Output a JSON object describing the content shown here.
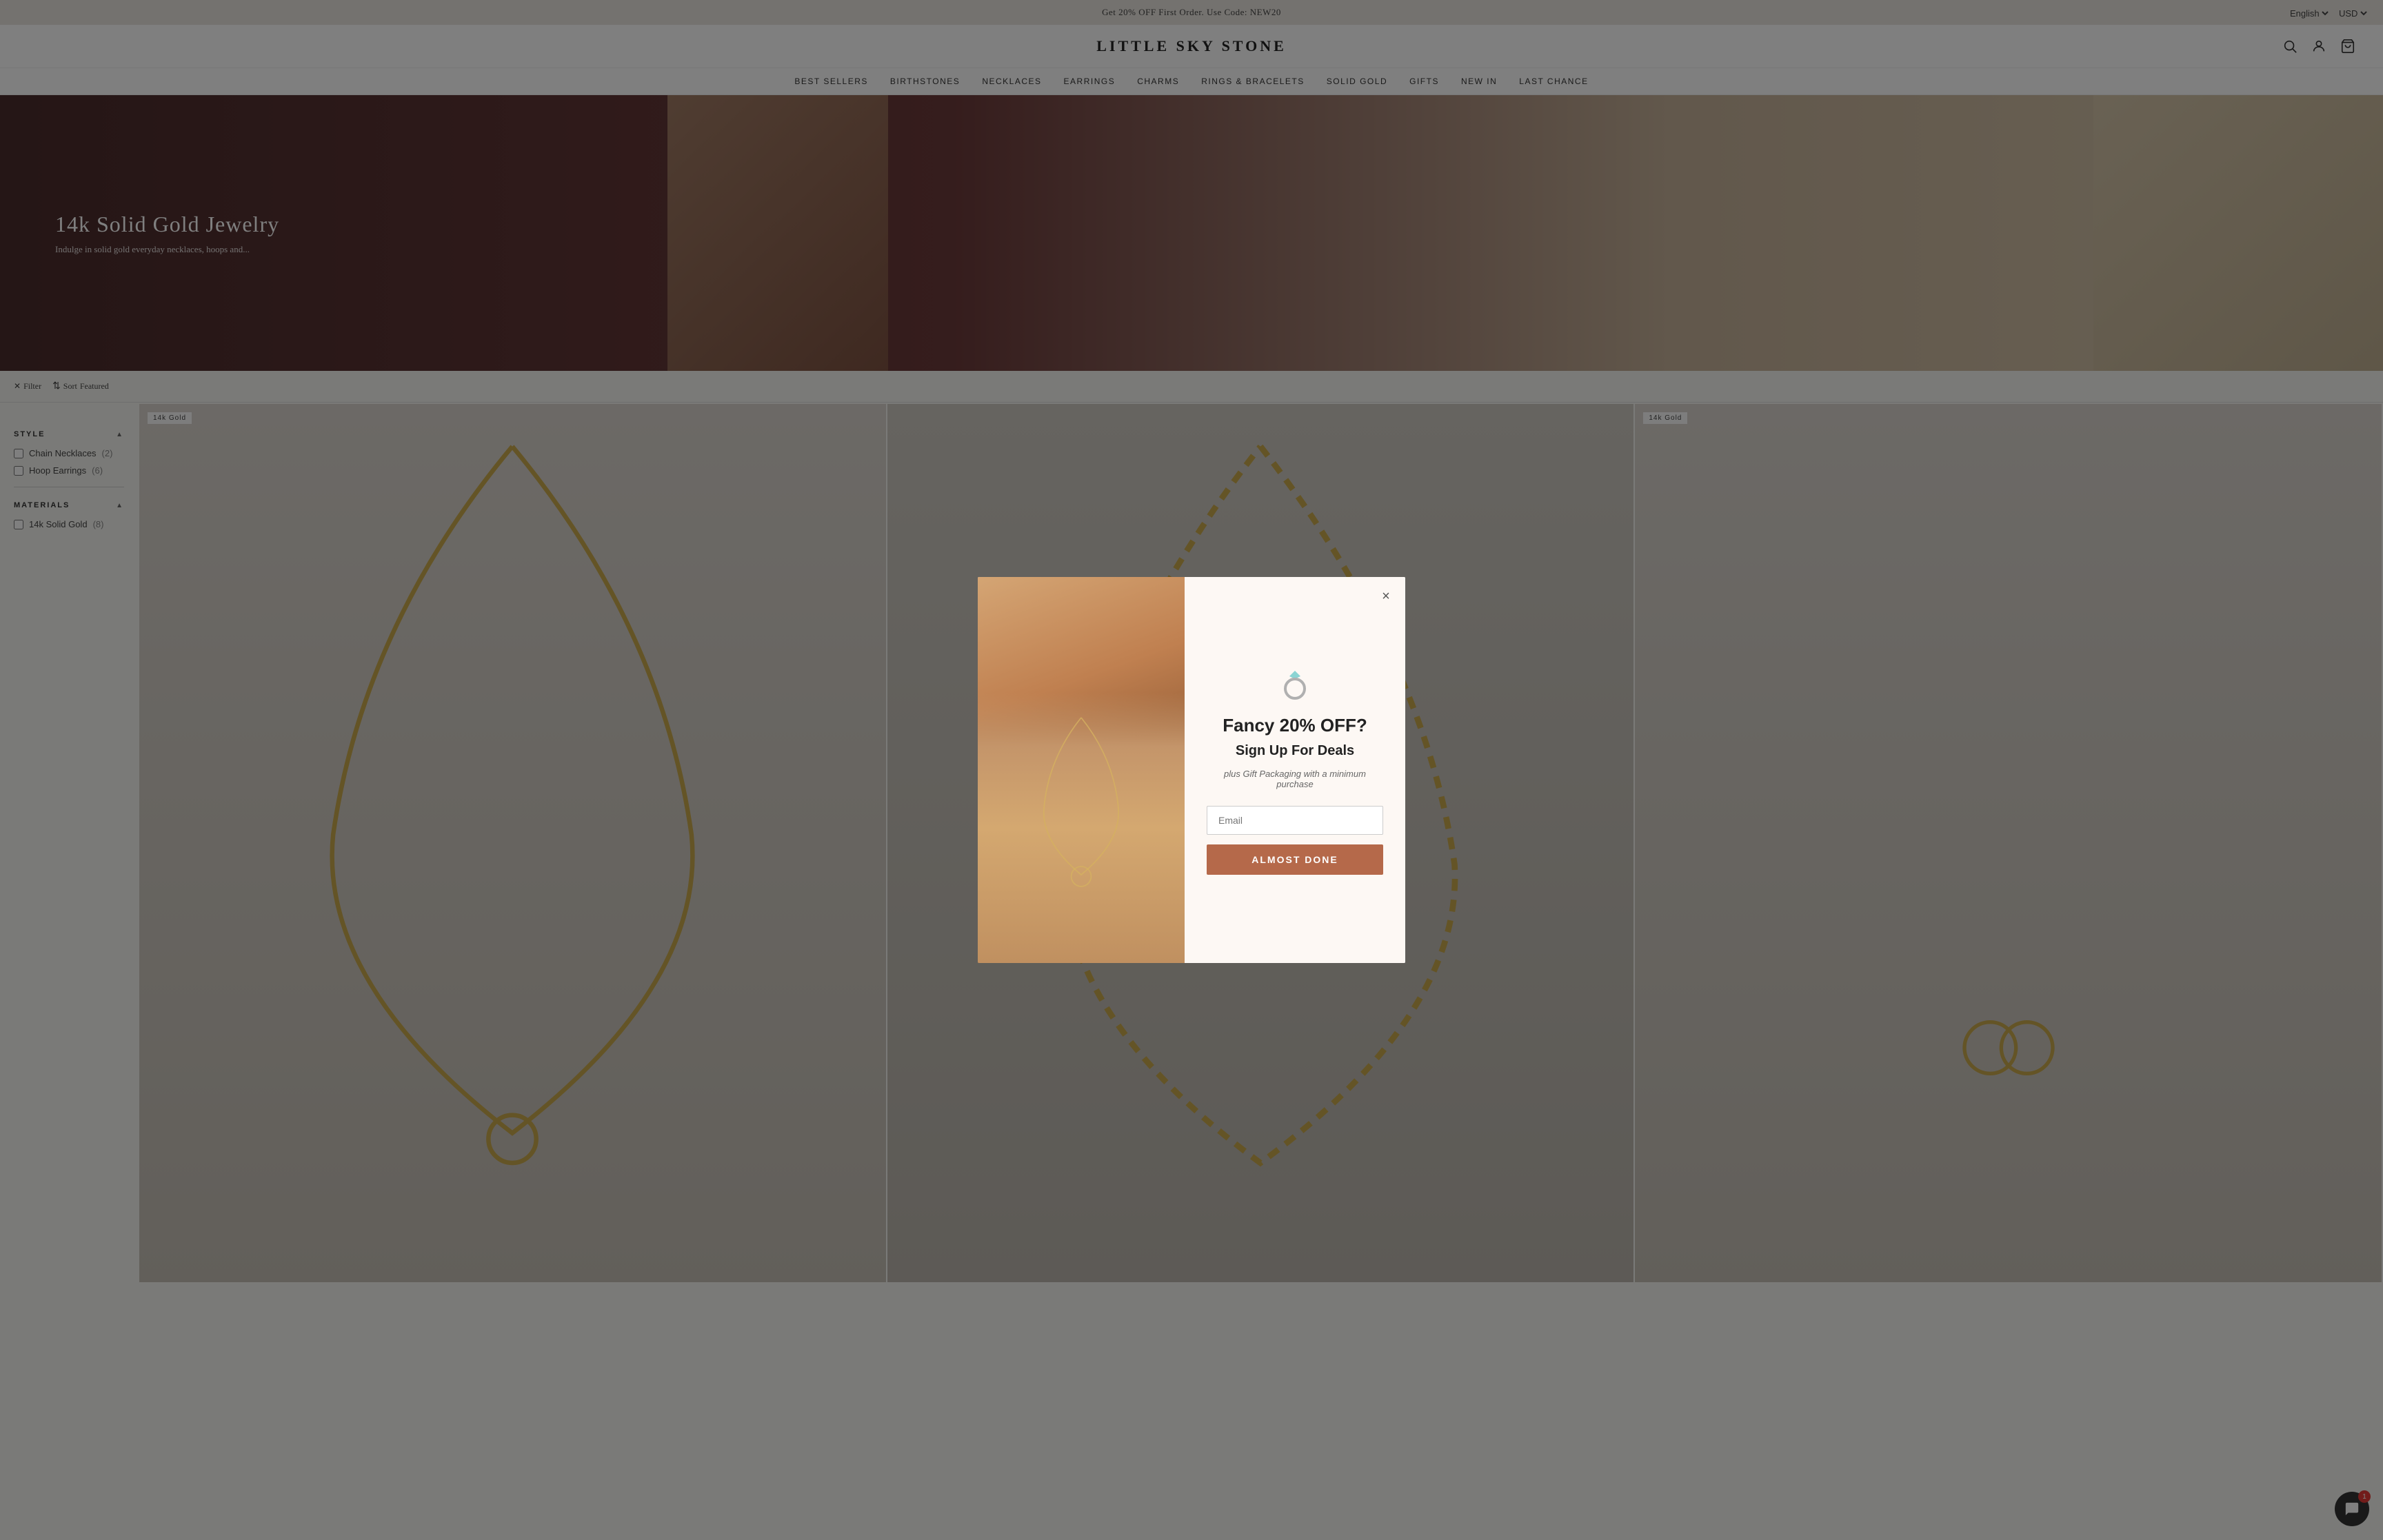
{
  "banner": {
    "promo_text": "Get 20% OFF First Order. Use Code: NEW20",
    "language": "English",
    "currency": "USD"
  },
  "header": {
    "logo": "LITTLE SKY STONE",
    "icons": {
      "search": "search-icon",
      "account": "account-icon",
      "cart": "cart-icon"
    }
  },
  "nav": {
    "items": [
      {
        "label": "BEST SELLERS",
        "id": "best-sellers"
      },
      {
        "label": "BIRTHSTONES",
        "id": "birthstones"
      },
      {
        "label": "NECKLACES",
        "id": "necklaces"
      },
      {
        "label": "EARRINGS",
        "id": "earrings"
      },
      {
        "label": "CHARMS",
        "id": "charms"
      },
      {
        "label": "RINGS & BRACELETS",
        "id": "rings-bracelets"
      },
      {
        "label": "SOLID GOLD",
        "id": "solid-gold"
      },
      {
        "label": "GIFTS",
        "id": "gifts"
      },
      {
        "label": "NEW IN",
        "id": "new-in"
      },
      {
        "label": "LAST CHANCE",
        "id": "last-chance"
      }
    ]
  },
  "hero": {
    "title": "14k Solid Gold Jewelry",
    "subtitle": "Indulge in solid gold everyday necklaces, hoops and..."
  },
  "filter_bar": {
    "filter_label": "Filter",
    "sort_label": "Sort",
    "sort_value": "Featured"
  },
  "sidebar": {
    "style_section": "STYLE",
    "filters_style": [
      {
        "label": "Chain Necklaces",
        "count": 2
      },
      {
        "label": "Hoop Earrings",
        "count": 6
      }
    ],
    "materials_section": "MATERIALS",
    "filters_materials": [
      {
        "label": "14k Solid Gold",
        "count": 8
      }
    ]
  },
  "products": {
    "badge_14k": "14k Gold",
    "items": [
      {
        "id": 1,
        "badge": "14k Gold",
        "type": "necklace"
      },
      {
        "id": 2,
        "badge": "",
        "type": "necklace"
      },
      {
        "id": 3,
        "badge": "14k Gold",
        "type": "earring"
      }
    ]
  },
  "modal": {
    "close_label": "×",
    "ring_icon": "ring-icon",
    "title": "Fancy 20% OFF?",
    "subtitle": "Sign Up For Deals",
    "description": "plus Gift Packaging with a minimum purchase",
    "email_placeholder": "Email",
    "button_label": "ALMOST DONE"
  },
  "chat": {
    "badge_count": "1",
    "icon": "chat-icon"
  }
}
